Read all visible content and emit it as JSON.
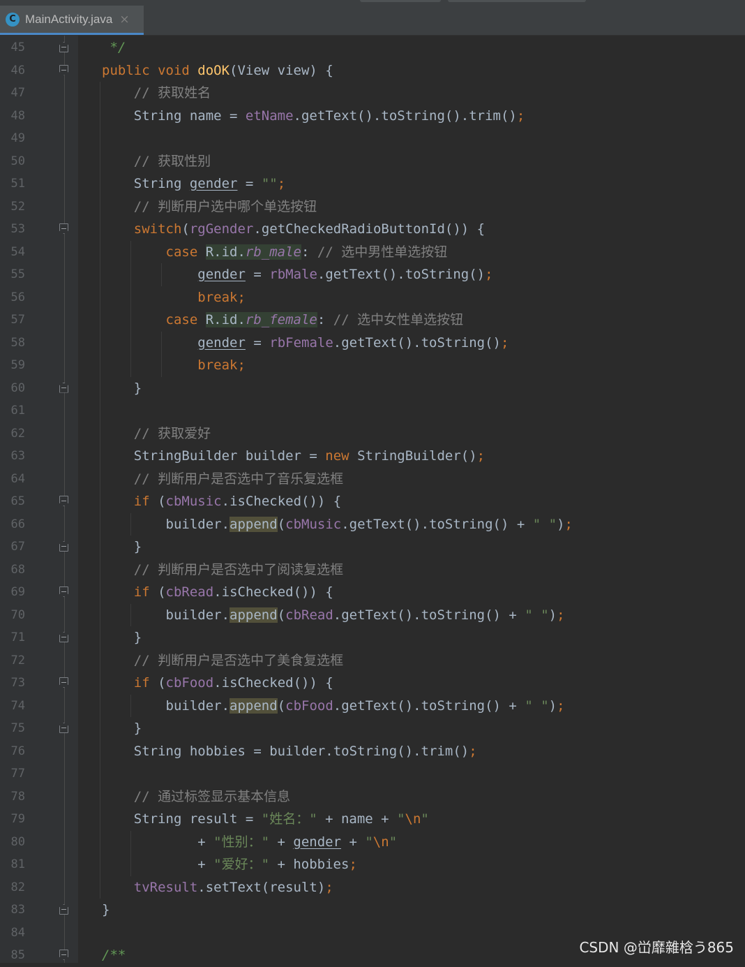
{
  "tab": {
    "title": "MainActivity.java",
    "icon_letter": "C",
    "close": "×"
  },
  "lines": [
    {
      "n": "45",
      "fold": "close",
      "html": "<span class=\"cmd\"> */</span>"
    },
    {
      "n": "46",
      "fold": "open",
      "html": "<span class=\"kw\">public void </span><span class=\"fn\">doOK</span>(View view) {"
    },
    {
      "n": "47",
      "fold": "",
      "html": "    <span class=\"cm\">// 获取姓名</span>"
    },
    {
      "n": "48",
      "fold": "",
      "html": "    String name = <span class=\"fd\">etName</span>.getText().toString().trim()<span class=\"kw\">;</span>"
    },
    {
      "n": "49",
      "fold": "",
      "html": ""
    },
    {
      "n": "50",
      "fold": "",
      "html": "    <span class=\"cm\">// 获取性别</span>"
    },
    {
      "n": "51",
      "fold": "",
      "html": "    String <span class=\"ul\">gender</span> = <span class=\"st\">\"\"</span><span class=\"kw\">;</span>"
    },
    {
      "n": "52",
      "fold": "",
      "html": "    <span class=\"cm\">// 判断用户选中哪个单选按钮</span>"
    },
    {
      "n": "53",
      "fold": "open",
      "html": "    <span class=\"kw\">switch</span>(<span class=\"fd\">rgGender</span>.getCheckedRadioButtonId()) {"
    },
    {
      "n": "54",
      "fold": "",
      "html": "        <span class=\"kw\">case </span><span class=\"hl\">R.id.<span class=\"fdi\">rb_male</span></span>: <span class=\"cm\">// 选中男性单选按钮</span>"
    },
    {
      "n": "55",
      "fold": "",
      "html": "            <span class=\"ul\">gender</span> = <span class=\"fd\">rbMale</span>.getText().toString()<span class=\"kw\">;</span>"
    },
    {
      "n": "56",
      "fold": "",
      "html": "            <span class=\"kw\">break;</span>"
    },
    {
      "n": "57",
      "fold": "",
      "html": "        <span class=\"kw\">case </span><span class=\"hl\">R.id.<span class=\"fdi\">rb_female</span></span>: <span class=\"cm\">// 选中女性单选按钮</span>"
    },
    {
      "n": "58",
      "fold": "",
      "html": "            <span class=\"ul\">gender</span> = <span class=\"fd\">rbFemale</span>.getText().toString()<span class=\"kw\">;</span>"
    },
    {
      "n": "59",
      "fold": "",
      "html": "            <span class=\"kw\">break;</span>"
    },
    {
      "n": "60",
      "fold": "close",
      "html": "    }"
    },
    {
      "n": "61",
      "fold": "",
      "html": ""
    },
    {
      "n": "62",
      "fold": "",
      "html": "    <span class=\"cm\">// 获取爱好</span>"
    },
    {
      "n": "63",
      "fold": "",
      "html": "    StringBuilder builder = <span class=\"kw\">new </span>StringBuilder()<span class=\"kw\">;</span>"
    },
    {
      "n": "64",
      "fold": "",
      "html": "    <span class=\"cm\">// 判断用户是否选中了音乐复选框</span>"
    },
    {
      "n": "65",
      "fold": "open",
      "html": "    <span class=\"kw\">if </span>(<span class=\"fd\">cbMusic</span>.isChecked()) {"
    },
    {
      "n": "66",
      "fold": "",
      "html": "        builder.<span class=\"hl2\">append</span>(<span class=\"fd\">cbMusic</span>.getText().toString() + <span class=\"st\">\" \"</span>)<span class=\"kw\">;</span>"
    },
    {
      "n": "67",
      "fold": "close",
      "html": "    }"
    },
    {
      "n": "68",
      "fold": "",
      "html": "    <span class=\"cm\">// 判断用户是否选中了阅读复选框</span>"
    },
    {
      "n": "69",
      "fold": "open",
      "html": "    <span class=\"kw\">if </span>(<span class=\"fd\">cbRead</span>.isChecked()) {"
    },
    {
      "n": "70",
      "fold": "",
      "html": "        builder.<span class=\"hl2\">append</span>(<span class=\"fd\">cbRead</span>.getText().toString() + <span class=\"st\">\" \"</span>)<span class=\"kw\">;</span>"
    },
    {
      "n": "71",
      "fold": "close",
      "html": "    }"
    },
    {
      "n": "72",
      "fold": "",
      "html": "    <span class=\"cm\">// 判断用户是否选中了美食复选框</span>"
    },
    {
      "n": "73",
      "fold": "open",
      "html": "    <span class=\"kw\">if </span>(<span class=\"fd\">cbFood</span>.isChecked()) {"
    },
    {
      "n": "74",
      "fold": "",
      "html": "        builder.<span class=\"hl2\">append</span>(<span class=\"fd\">cbFood</span>.getText().toString() + <span class=\"st\">\" \"</span>)<span class=\"kw\">;</span>"
    },
    {
      "n": "75",
      "fold": "close",
      "html": "    }"
    },
    {
      "n": "76",
      "fold": "",
      "html": "    String hobbies = builder.toString().trim()<span class=\"kw\">;</span>"
    },
    {
      "n": "77",
      "fold": "",
      "html": ""
    },
    {
      "n": "78",
      "fold": "",
      "html": "    <span class=\"cm\">// 通过标签显示基本信息</span>"
    },
    {
      "n": "79",
      "fold": "",
      "html": "    String result = <span class=\"st\">\"姓名：\"</span> + name + <span class=\"st\">\"</span><span class=\"kw\">\\n</span><span class=\"st\">\"</span>"
    },
    {
      "n": "80",
      "fold": "",
      "html": "            + <span class=\"st\">\"性别：\"</span> + <span class=\"ul\">gender</span> + <span class=\"st\">\"</span><span class=\"kw\">\\n</span><span class=\"st\">\"</span>"
    },
    {
      "n": "81",
      "fold": "",
      "html": "            + <span class=\"st\">\"爱好：\"</span> + hobbies<span class=\"kw\">;</span>"
    },
    {
      "n": "82",
      "fold": "",
      "html": "    <span class=\"fd\">tvResult</span>.setText(result)<span class=\"kw\">;</span>"
    },
    {
      "n": "83",
      "fold": "close",
      "html": "}"
    },
    {
      "n": "84",
      "fold": "",
      "html": ""
    },
    {
      "n": "85",
      "fold": "open",
      "html": "<span class=\"cmd\">/**</span>"
    }
  ],
  "watermark": "CSDN @峃靡雜梒う865",
  "colors": {
    "background": "#2b2b2b",
    "keyword": "#cc7832",
    "method": "#ffc66d",
    "field": "#9876aa",
    "string": "#6a8759",
    "comment": "#808080",
    "doc_comment": "#629755",
    "text": "#a9b7c6"
  }
}
